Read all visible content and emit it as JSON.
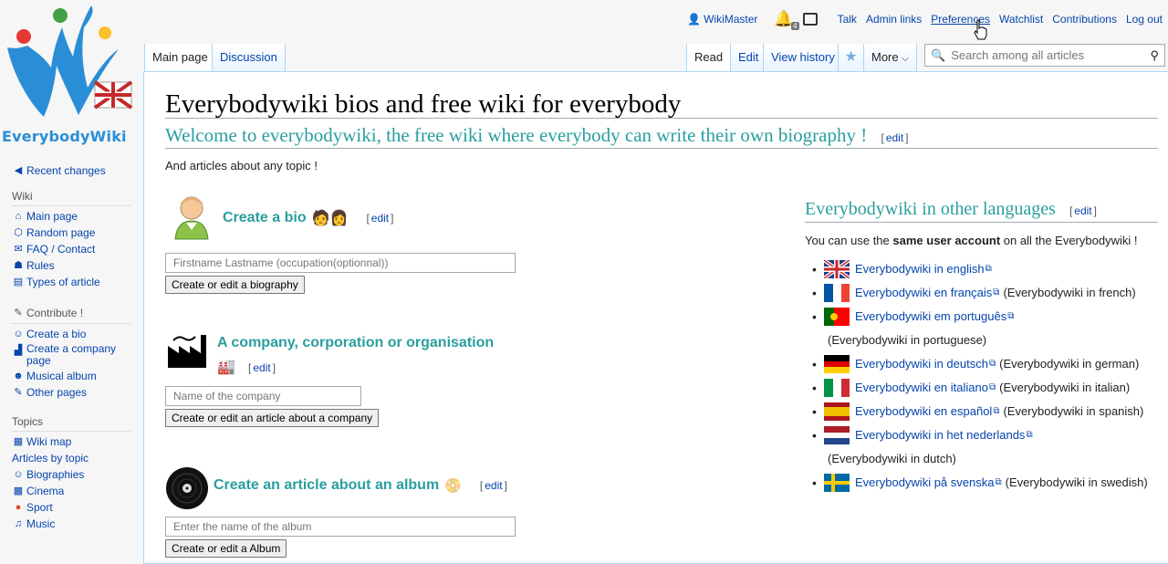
{
  "logo": {
    "text": "EverybodyWiki"
  },
  "personal": {
    "username": "WikiMaster",
    "notif_count": "4",
    "links": [
      "Talk",
      "Admin links",
      "Preferences",
      "Watchlist",
      "Contributions",
      "Log out"
    ]
  },
  "tabs": {
    "left": [
      "Main page",
      "Discussion"
    ],
    "right": [
      "Read",
      "Edit",
      "View history",
      "More"
    ]
  },
  "search": {
    "placeholder": "Search among all articles"
  },
  "sidebar": {
    "top": [
      {
        "icon": "◀",
        "label": "Recent changes"
      }
    ],
    "wiki_head": "Wiki",
    "wiki": [
      {
        "icon": "⌂",
        "label": "Main page"
      },
      {
        "icon": "⬡",
        "label": "Random page"
      },
      {
        "icon": "✉",
        "label": "FAQ / Contact"
      },
      {
        "icon": "☗",
        "label": "Rules"
      },
      {
        "icon": "▤",
        "label": "Types of article"
      }
    ],
    "contribute_head": "Contribute !",
    "contribute": [
      {
        "icon": "☺",
        "label": "Create a bio"
      },
      {
        "icon": "▟",
        "label": "Create a company page"
      },
      {
        "icon": "☻",
        "label": "Musical album"
      },
      {
        "icon": "✎",
        "label": "Other pages"
      }
    ],
    "topics_head": "Topics",
    "topics": [
      {
        "icon": "▦",
        "label": "Wiki map"
      },
      {
        "icon": "",
        "label": "Articles by topic"
      },
      {
        "icon": "☺",
        "label": "Biographies"
      },
      {
        "icon": "▩",
        "label": "Cinema"
      },
      {
        "icon": "●",
        "label": "Sport"
      },
      {
        "icon": "♫",
        "label": "Music"
      }
    ]
  },
  "main": {
    "title": "Everybodywiki bios and free wiki for everybody",
    "welcome": "Welcome to everybodywiki, the free wiki where everybody can write their own biography !",
    "edit_label": "edit",
    "intro": "And articles about any topic !",
    "bio": {
      "heading": "Create a bio",
      "placeholder": "Firstname Lastname (occupation(optionnal))",
      "button": "Create or edit a biography"
    },
    "company": {
      "heading": "A company, corporation or organisation",
      "placeholder": "Name of the company",
      "button": "Create or edit an article about a company"
    },
    "album": {
      "heading": "Create an article about an album",
      "placeholder": "Enter the name of the album",
      "button": "Create or edit a Album"
    }
  },
  "languages": {
    "heading": "Everybodywiki in other languages",
    "intro_pre": "You can use the ",
    "intro_bold": "same user account",
    "intro_post": " on all the Everybodywiki !",
    "items": [
      {
        "flag": "uk",
        "link": "Everybodywiki in english",
        "note": ""
      },
      {
        "flag": "fr",
        "link": "Everybodywiki en français",
        "note": "(Everybodywiki in french)"
      },
      {
        "flag": "pt",
        "link": "Everybodywiki em português",
        "note": "(Everybodywiki in portuguese)"
      },
      {
        "flag": "de",
        "link": "Everybodywiki in deutsch",
        "note": "(Everybodywiki in german)"
      },
      {
        "flag": "it",
        "link": "Everybodywiki en italiano",
        "note": "(Everybodywiki in italian)"
      },
      {
        "flag": "es",
        "link": "Everybodywiki en español",
        "note": "(Everybodywiki in spanish)"
      },
      {
        "flag": "nl",
        "link": "Everybodywiki in het nederlands",
        "note": "(Everybodywiki in dutch)"
      },
      {
        "flag": "se",
        "link": "Everybodywiki på svenska",
        "note": "(Everybodywiki in swedish)"
      }
    ]
  },
  "colors": {
    "link": "#0645ad",
    "heading": "#2a9e9e",
    "logo_blue": "#2a8ed6"
  }
}
